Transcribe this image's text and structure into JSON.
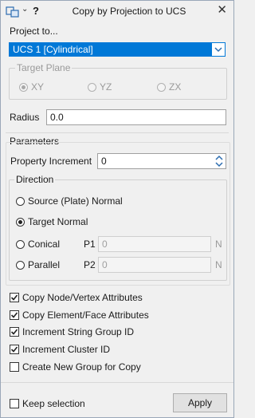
{
  "window": {
    "title": "Copy by Projection to UCS",
    "help": "?",
    "close": "✕"
  },
  "project_to": {
    "title": "Project to...",
    "selected": "UCS 1 [Cylindrical]",
    "target_plane": {
      "title": "Target Plane",
      "options": [
        "XY",
        "YZ",
        "ZX"
      ],
      "selected": "XY"
    },
    "radius_label": "Radius",
    "radius_value": "0.0"
  },
  "parameters": {
    "title": "Parameters",
    "property_increment_label": "Property Increment",
    "property_increment_value": "0",
    "direction": {
      "title": "Direction",
      "source_normal": "Source (Plate) Normal",
      "target_normal": "Target Normal",
      "conical": "Conical",
      "parallel": "Parallel",
      "selected": "Target Normal",
      "p1_label": "P1",
      "p1_value": "0",
      "p2_label": "P2",
      "p2_value": "0",
      "unit": "N"
    }
  },
  "options": [
    {
      "label": "Copy Node/Vertex Attributes",
      "checked": true
    },
    {
      "label": "Copy Element/Face Attributes",
      "checked": true
    },
    {
      "label": "Increment String Group ID",
      "checked": true
    },
    {
      "label": "Increment Cluster ID",
      "checked": true
    },
    {
      "label": "Create New Group for Copy",
      "checked": false
    }
  ],
  "footer": {
    "keep_selection_label": "Keep selection",
    "keep_selection_checked": false,
    "apply_label": "Apply"
  }
}
